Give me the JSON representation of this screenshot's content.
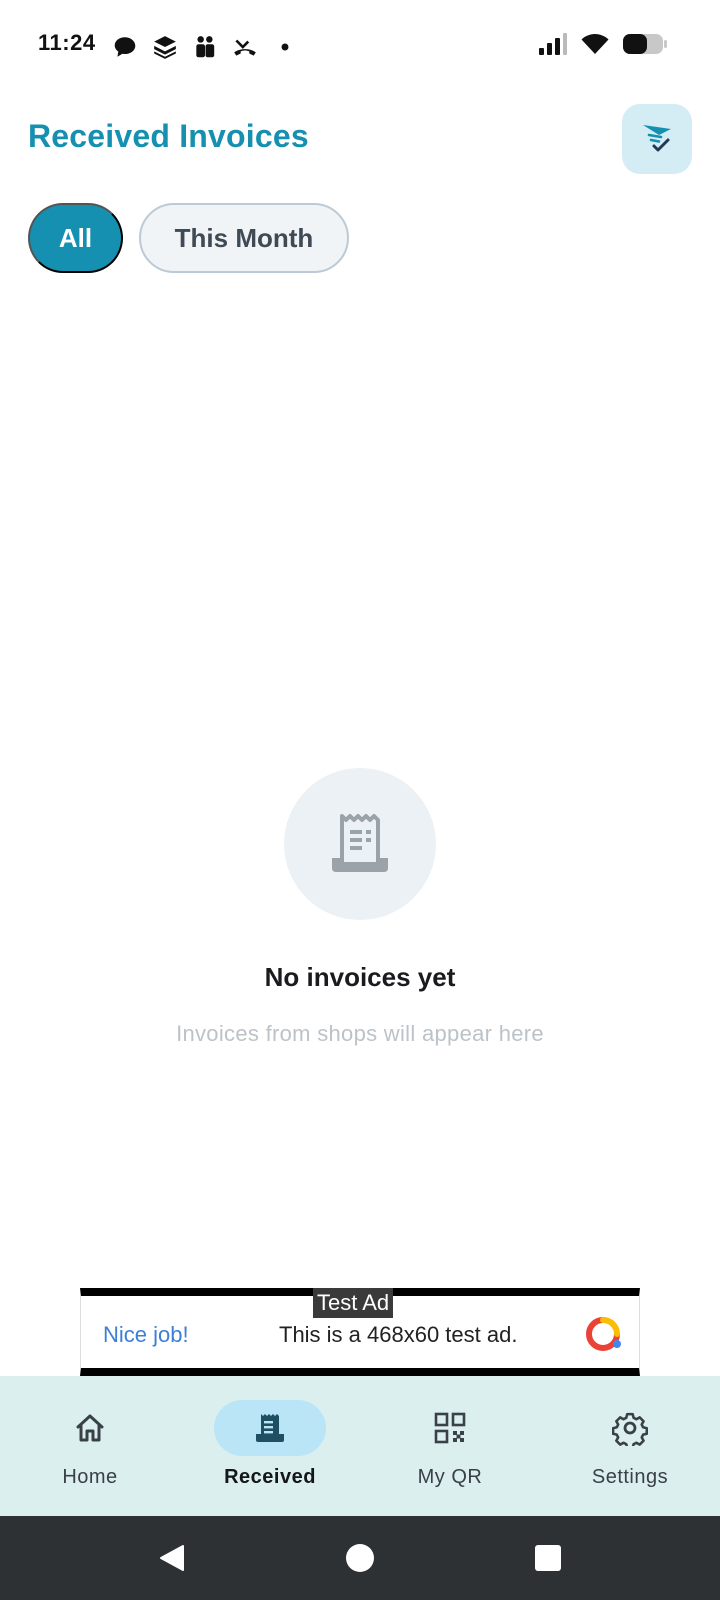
{
  "status_bar": {
    "time": "11:24",
    "notification_icons": [
      "chat-bubble-icon",
      "stack-icon",
      "people-icon",
      "missed-call-icon",
      "dot-icon"
    ],
    "system_icons": [
      "cell-signal-icon",
      "wifi-icon",
      "battery-icon"
    ]
  },
  "header": {
    "title": "Received Invoices",
    "action_icon": "filter-icon"
  },
  "filters": {
    "chips": [
      {
        "label": "All",
        "selected": true
      },
      {
        "label": "This Month",
        "selected": false
      }
    ]
  },
  "empty_state": {
    "icon": "receipt-icon",
    "title": "No invoices yet",
    "subtitle": "Invoices from shops will appear here"
  },
  "ad": {
    "label": "Test Ad",
    "headline": "Nice job!",
    "body": "This is a 468x60 test ad."
  },
  "bottom_nav": {
    "items": [
      {
        "label": "Home",
        "icon": "home-icon",
        "active": false
      },
      {
        "label": "Received",
        "icon": "receipt-icon",
        "active": true
      },
      {
        "label": "My QR",
        "icon": "qr-code-icon",
        "active": false
      },
      {
        "label": "Settings",
        "icon": "gear-icon",
        "active": false
      }
    ]
  },
  "colors": {
    "accent": "#1590b0",
    "nav_background": "#dcefef",
    "nav_active_pill": "#b9e5f7"
  }
}
